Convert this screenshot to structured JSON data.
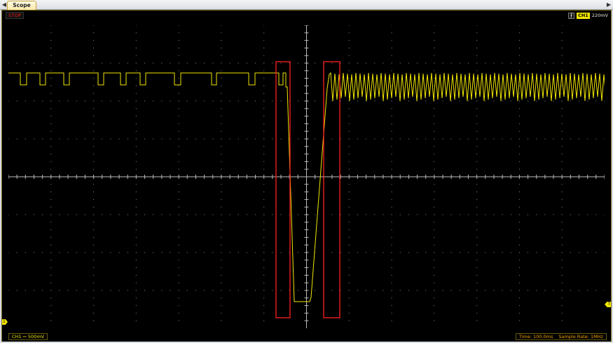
{
  "tab": {
    "title": "Scope"
  },
  "status": {
    "run_state": "STOP"
  },
  "trigger": {
    "edge_icon": "rising-edge-icon",
    "channel": "CH1",
    "level": "220mV"
  },
  "channel": {
    "label": "CH1",
    "coupling_symbol": "⎓",
    "scale": "500mV"
  },
  "timing": {
    "time": "Time: 100.0ms",
    "sample_rate": "Sample Rate: 1MHz"
  },
  "markers": {
    "ground": "1",
    "trigger": "T"
  },
  "colors": {
    "trace": "#f2e600",
    "grid": "#8a8a8a",
    "highlight": "#ff2020",
    "background": "#000000",
    "stop": "#ff2020",
    "timing": "#f2a000"
  },
  "highlight_boxes": 2
}
